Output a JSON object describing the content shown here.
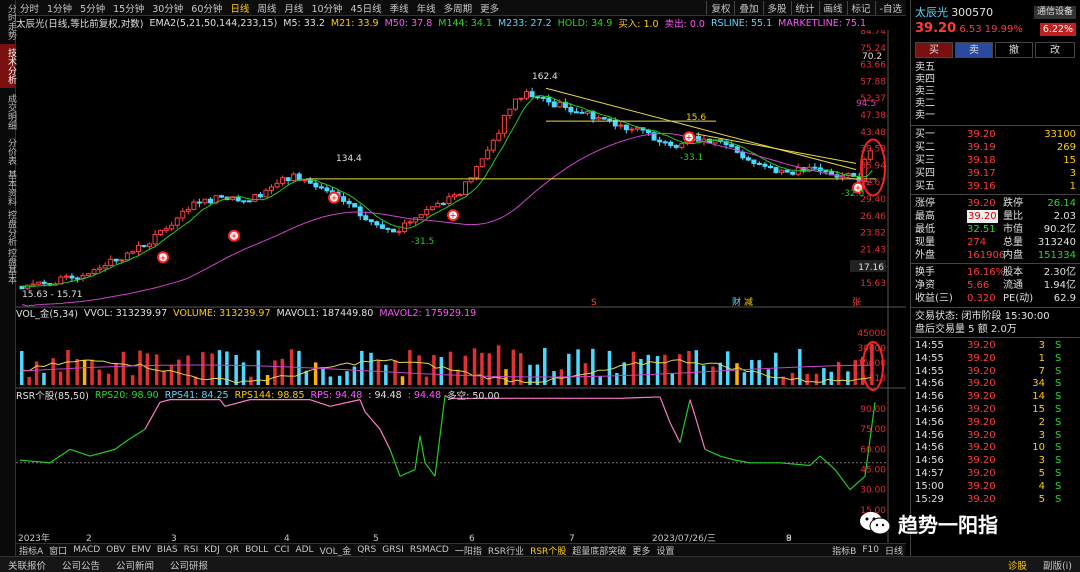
{
  "vtabs": [
    "分时走势",
    "技术分析",
    "成交明细",
    "分价表",
    "基本资料",
    "控盘分析",
    "控盘基本"
  ],
  "periods": [
    "分时",
    "1分钟",
    "5分钟",
    "15分钟",
    "30分钟",
    "60分钟",
    "日线",
    "周线",
    "月线",
    "10分钟",
    "45日线",
    "季线",
    "年线",
    "多周期",
    "更多"
  ],
  "active_period": "日线",
  "toolbar": [
    "复权",
    "叠加",
    "多股",
    "统计",
    "画线",
    "标记",
    "-自选"
  ],
  "main_legend": {
    "title": "太辰光(日线,等比前复权,对数)",
    "ema": "EMA2(5,21,50,144,233,15)",
    "m5": "M5: 33.2",
    "m21": "M21: 33.9",
    "m50": "M50: 37.8",
    "m144": "M144: 34.1",
    "m233": "M233: 27.2",
    "hold": "HOLD: 34.9",
    "buy": "买入: 1.0",
    "sell": "卖出: 0.0",
    "rsline": "RSLINE: 55.1",
    "market": "MARKETLINE: 75.1"
  },
  "vol_legend": {
    "title": "VOL_金(5,34)",
    "vvol": "VVOL: 313239.97",
    "volume": "VOLUME: 313239.97",
    "mavol1": "MAVOL1: 187449.80",
    "mavol2": "MAVOL2: 175929.19"
  },
  "rsr_legend": {
    "title": "RSR个股(85,50)",
    "rps20": "RPS20: 98.90",
    "rps41": "RPS41: 84.25",
    "rps144": "RPS144: 98.85",
    "rps": "RPS: 94.48",
    "v1": ": 94.48",
    "v2": ": 94.48",
    "duokong": "多空: 50.00"
  },
  "annotations": {
    "peak1": "134.4",
    "peak2": "162.4",
    "peak3": "15.6",
    "low1": "-31.5",
    "low2": "-33.1",
    "low3": "-32.0",
    "range_label": "15.63 - 15.71",
    "price_mark": "17.16",
    "p70": "70.2",
    "p94": "94.5",
    "mark_s": "S",
    "mark_cai": "财",
    "mark_jian": "减",
    "mark_zhang": "张"
  },
  "price_axis": [
    "84.74",
    "75.24",
    "63.66",
    "57.88",
    "52.37",
    "47.38",
    "43.48",
    "39.53",
    "35.94",
    "32.67",
    "29.40",
    "26.46",
    "23.82",
    "21.43",
    "19.29",
    "15.63"
  ],
  "vol_axis": [
    "45000",
    "30000",
    "15000",
    "X10"
  ],
  "rsr_axis": [
    "90.00",
    "75.00",
    "60.00",
    "45.00",
    "30.00",
    "15.00"
  ],
  "date_axis": [
    "2023年",
    "2",
    "3",
    "4",
    "5",
    "6",
    "7",
    "2023/07/26/三",
    "8",
    "9"
  ],
  "bottom_tabs": [
    "指标A",
    "窗口",
    "MACD",
    "OBV",
    "EMV",
    "BIAS",
    "RSI",
    "KDJ",
    "QR",
    "BOLL",
    "CCI",
    "ADL",
    "VOL_金",
    "QRS",
    "GRSI",
    "RSMACD",
    "一阳指",
    "RSR行业",
    "RSR个股",
    "超量底部突破",
    "更多",
    "设置"
  ],
  "active_bottom_tab": "RSR个股",
  "bottom_right": [
    "指标B",
    "F10",
    "日线"
  ],
  "status_bar": [
    "关联报价",
    "公司公告",
    "公司新闻",
    "公司研报"
  ],
  "status_right": [
    "诊股",
    "副版(i)"
  ],
  "quote": {
    "name": "太辰光",
    "code": "300570",
    "tag": "通信设备",
    "price": "39.20",
    "change": "6.53",
    "pct": "19.99%",
    "turnover_badge": "6.22%",
    "trade_buttons": [
      "买",
      "卖",
      "撤",
      "改"
    ],
    "sell_levels": [
      "卖五",
      "卖四",
      "卖三",
      "卖二",
      "卖一"
    ],
    "buy_levels": [
      {
        "label": "买一",
        "price": "39.20",
        "vol": "33100"
      },
      {
        "label": "买二",
        "price": "39.19",
        "vol": "269"
      },
      {
        "label": "买三",
        "price": "39.18",
        "vol": "15"
      },
      {
        "label": "买四",
        "price": "39.17",
        "vol": "3"
      },
      {
        "label": "买五",
        "price": "39.16",
        "vol": "1"
      }
    ],
    "stats": [
      {
        "k1": "涨停",
        "v1": "39.20",
        "k2": "跌停",
        "v2": "26.14"
      },
      {
        "k1": "最高",
        "v1": "39.20",
        "k2": "量比",
        "v2": "2.03"
      },
      {
        "k1": "最低",
        "v1": "32.51",
        "k2": "市值",
        "v2": "90.2亿"
      },
      {
        "k1": "现量",
        "v1": "274",
        "k2": "总量",
        "v2": "313240"
      },
      {
        "k1": "外盘",
        "v1": "161906",
        "k2": "内盘",
        "v2": "151334"
      }
    ],
    "stats2": [
      {
        "k1": "换手",
        "v1": "16.16%",
        "k2": "股本",
        "v2": "2.30亿"
      },
      {
        "k1": "净资",
        "v1": "5.66",
        "k2": "流通",
        "v2": "1.94亿"
      },
      {
        "k1": "收益(三)",
        "v1": "0.320",
        "k2": "PE(动)",
        "v2": "62.9"
      }
    ],
    "trade_status": "交易状态: 闭市阶段 15:30:00",
    "after_hours": "盘后交易量 5 额 2.0万",
    "ticks": [
      {
        "t": "14:55",
        "p": "39.20",
        "v": "3",
        "s": "S"
      },
      {
        "t": "14:55",
        "p": "39.20",
        "v": "1",
        "s": "S"
      },
      {
        "t": "14:55",
        "p": "39.20",
        "v": "7",
        "s": "S"
      },
      {
        "t": "14:56",
        "p": "39.20",
        "v": "34",
        "s": "S"
      },
      {
        "t": "14:56",
        "p": "39.20",
        "v": "14",
        "s": "S"
      },
      {
        "t": "14:56",
        "p": "39.20",
        "v": "15",
        "s": "S"
      },
      {
        "t": "14:56",
        "p": "39.20",
        "v": "2",
        "s": "S"
      },
      {
        "t": "14:56",
        "p": "39.20",
        "v": "3",
        "s": "S"
      },
      {
        "t": "14:56",
        "p": "39.20",
        "v": "10",
        "s": "S"
      },
      {
        "t": "14:56",
        "p": "39.20",
        "v": "3",
        "s": "S"
      },
      {
        "t": "14:57",
        "p": "39.20",
        "v": "5",
        "s": "S"
      },
      {
        "t": "15:00",
        "p": "39.20",
        "v": "4",
        "s": "S"
      },
      {
        "t": "15:29",
        "p": "39.20",
        "v": "5",
        "s": "S"
      }
    ],
    "side_nums": [
      "1",
      "1",
      "1",
      "1",
      "57",
      "1"
    ]
  },
  "watermark": "趋势一阳指"
}
